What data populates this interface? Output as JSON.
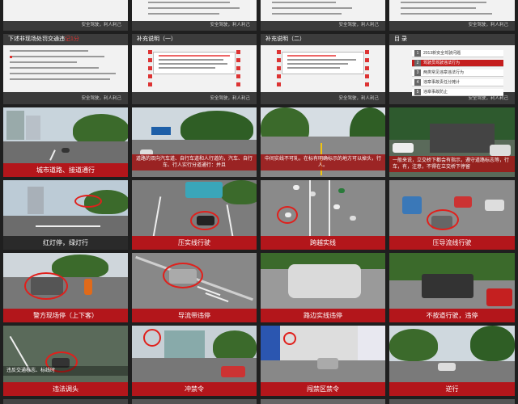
{
  "row1": [
    {
      "footer": "安全驾驶，利人利己"
    },
    {
      "footer": "安全驾驶，利人利己"
    },
    {
      "footer": "安全驾驶，利人利己"
    },
    {
      "footer": "安全驾驶，利人利己"
    }
  ],
  "row2": [
    {
      "title_prefix": "下述非现场处罚交通违",
      "title_highlight": "记1分",
      "footer": "安全驾驶，利人利己"
    },
    {
      "title": "补充说明（一）",
      "footer": "安全驾驶，利人利己"
    },
    {
      "title": "补充说明（二）",
      "footer": "安全驾驶，利人利己"
    },
    {
      "title": "目 录",
      "footer": "安全驾驶，利人利己",
      "toc": [
        {
          "num": "1",
          "label": "2013新安全驾驶问题"
        },
        {
          "num": "2",
          "label": "驾驶员驾驶违法行为"
        },
        {
          "num": "3",
          "label": "两类常见违章违法行为"
        },
        {
          "num": "4",
          "label": "违章事故责任分摊计"
        },
        {
          "num": "5",
          "label": "违章事故防止"
        },
        {
          "num": "6",
          "label": "关于车辆申报、保险问题"
        }
      ]
    }
  ],
  "captions": {
    "r3c1": "城市道路、接道通行",
    "r3c2_overlay": "道路的双向汽车道、自行车道和人行道的，汽车、自行车、行人实行分道通行：并且",
    "r3c3_overlay": "中间实线不可轧，在标有明确标示的地方可以掉头，行人。",
    "r3c4_overlay": "一般来说，立交桥下都会有指示，遵守道路标志等，行车，有，注意，不得在立交桥下停留",
    "r4c1": "红灯停，绿灯行",
    "r4c2": "压实线行驶",
    "r4c3": "跨越实线",
    "r4c4": "压导流线行驶",
    "r5c1": "警方现场停（上下客）",
    "r5c2": "导流带违停",
    "r5c3": "路边实线违停",
    "r5c4": "不按道行驶，违停",
    "r6c1": "违法调头",
    "r6c2": "冲禁令",
    "r6c3": "闯禁区禁令",
    "r6c4": "逆行",
    "r6c1_overlay": "违反交通标志、标线时"
  },
  "colors": {
    "accent": "#b3161b",
    "bg": "#1f1f1f"
  }
}
